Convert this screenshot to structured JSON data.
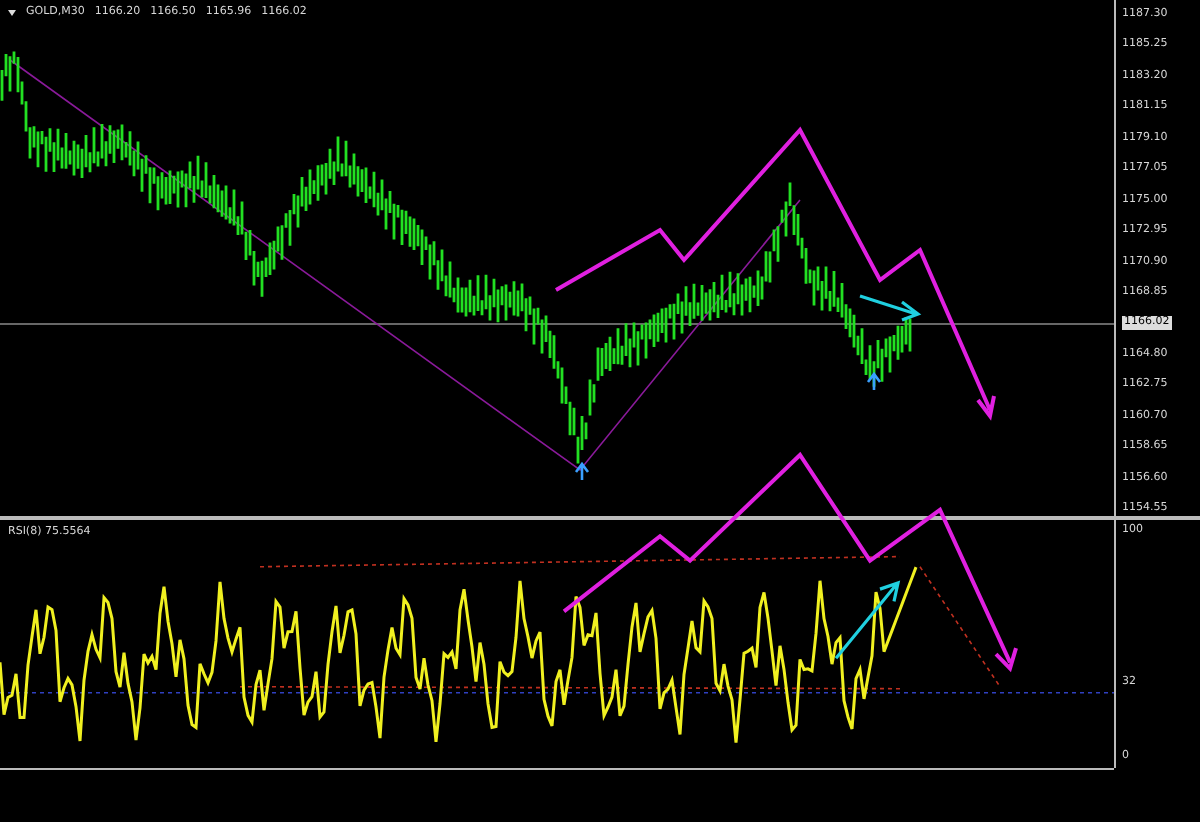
{
  "chart_header": {
    "symbol": "GOLD,M30",
    "quotes": [
      "1166.20",
      "1166.50",
      "1165.96",
      "1166.02"
    ]
  },
  "price_axis": {
    "labels": [
      {
        "text": "1187.30",
        "current": false
      },
      {
        "text": "1185.25",
        "current": false
      },
      {
        "text": "1183.20",
        "current": false
      },
      {
        "text": "1181.15",
        "current": false
      },
      {
        "text": "1179.10",
        "current": false
      },
      {
        "text": "1177.05",
        "current": false
      },
      {
        "text": "1175.00",
        "current": false
      },
      {
        "text": "1172.95",
        "current": false
      },
      {
        "text": "1170.90",
        "current": false
      },
      {
        "text": "1168.85",
        "current": false
      },
      {
        "text": "1166.02",
        "current": true
      },
      {
        "text": "1164.80",
        "current": false
      },
      {
        "text": "1162.75",
        "current": false
      },
      {
        "text": "1160.70",
        "current": false
      },
      {
        "text": "1158.65",
        "current": false
      },
      {
        "text": "1156.60",
        "current": false
      },
      {
        "text": "1154.55",
        "current": false
      }
    ]
  },
  "indicator": {
    "label": "RSI(8) 75.5564",
    "axis_labels": [
      "100",
      "32",
      "0"
    ]
  }
}
